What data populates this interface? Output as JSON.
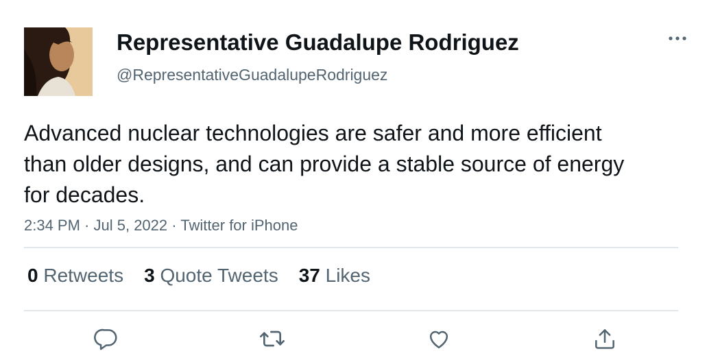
{
  "author": {
    "name": "Representative Guadalupe Rodriguez",
    "handle": "@RepresentativeGuadalupeRodriguez"
  },
  "tweet": {
    "text": "Advanced nuclear technologies are safer and more efficient than older designs, and can provide a stable source of energy for decades.",
    "time": "2:34 PM",
    "date": "Jul 5, 2022",
    "source": "Twitter for iPhone",
    "separator": " · "
  },
  "stats": {
    "retweets": {
      "count": "0",
      "label": "Retweets"
    },
    "quotes": {
      "count": "3",
      "label": "Quote Tweets"
    },
    "likes": {
      "count": "37",
      "label": "Likes"
    }
  },
  "actions": {
    "reply_icon": "reply-icon",
    "retweet_icon": "retweet-icon",
    "like_icon": "heart-icon",
    "share_icon": "share-icon",
    "more_icon": "more-icon"
  },
  "colors": {
    "text": "#0f1419",
    "secondary": "#536471",
    "divider": "#e1e6ea"
  }
}
